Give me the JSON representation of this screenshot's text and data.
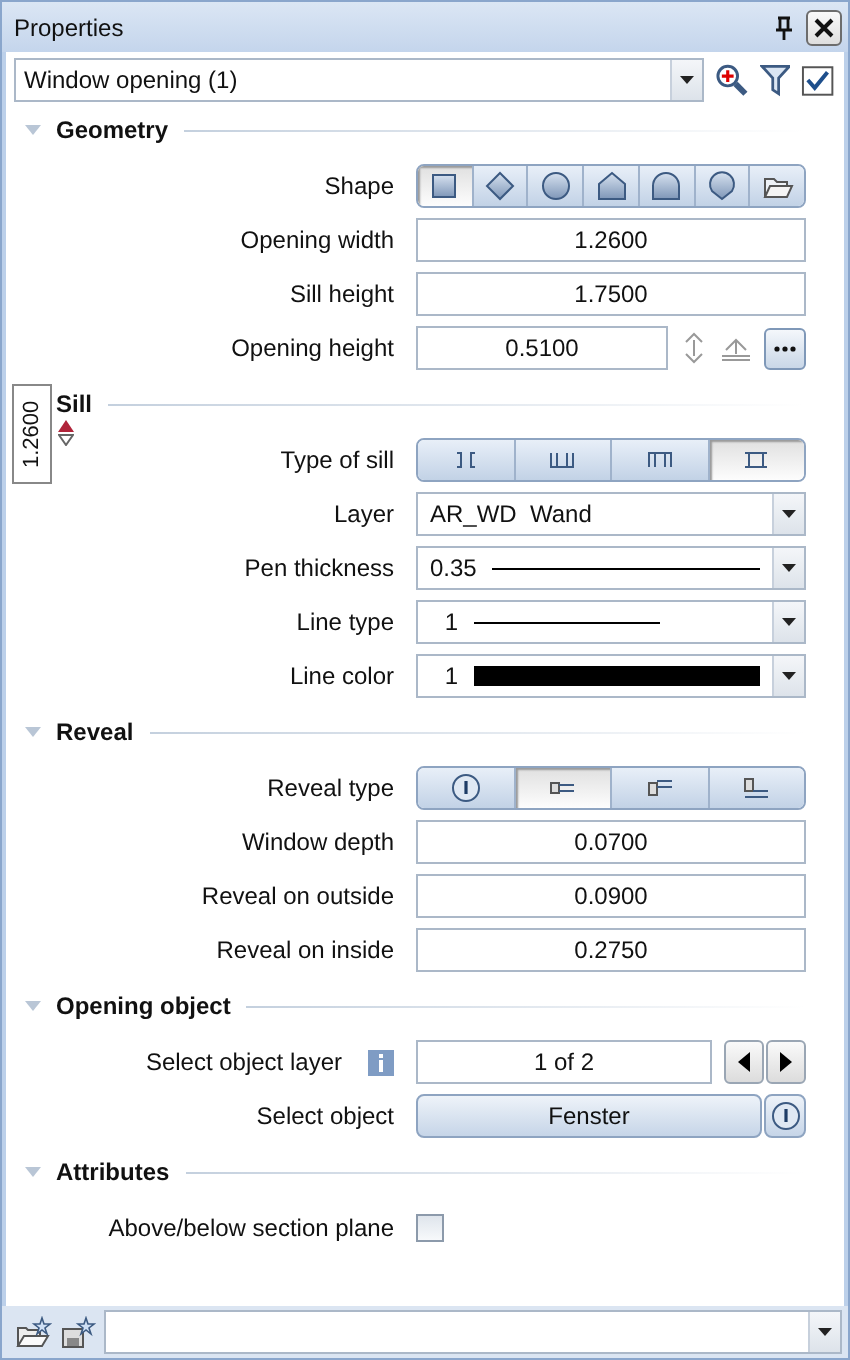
{
  "window": {
    "title": "Properties"
  },
  "selector": {
    "value": "Window opening (1)"
  },
  "sections": [
    {
      "title": "Geometry",
      "expanded": true,
      "rows": [
        {
          "kind": "shapes",
          "label": "Shape",
          "options": [
            {
              "selected": true
            },
            {
              "selected": false
            },
            {
              "selected": false
            },
            {
              "selected": false
            },
            {
              "selected": false
            },
            {
              "selected": false
            },
            {
              "selected": false
            }
          ]
        },
        {
          "kind": "number",
          "label": "Opening width",
          "value": "1.2600"
        },
        {
          "kind": "number",
          "label": "Sill height",
          "value": "1.7500"
        },
        {
          "kind": "tools",
          "label": "Opening height",
          "value": "0.5100"
        }
      ]
    },
    {
      "title": "Sill",
      "rows": [
        {
          "kind": "sills",
          "label": "Type of sill",
          "options": [
            {
              "selected": false
            },
            {
              "selected": false
            },
            {
              "selected": false
            },
            {
              "selected": true
            }
          ]
        },
        {
          "kind": "dropdown",
          "label": "Layer",
          "value": "AR_WD  Wand"
        },
        {
          "kind": "pen",
          "label": "Pen thickness",
          "value": "0.35"
        },
        {
          "kind": "linetype",
          "label": "Line type",
          "value": "1"
        },
        {
          "kind": "color",
          "label": "Line color",
          "value": "1"
        }
      ]
    },
    {
      "title": "Reveal",
      "expanded": true,
      "rows": [
        {
          "kind": "reveals",
          "label": "Reveal type",
          "options": [
            {
              "selected": false
            },
            {
              "selected": true
            },
            {
              "selected": false
            },
            {
              "selected": false
            }
          ]
        },
        {
          "kind": "number",
          "label": "Window depth",
          "value": "0.0700"
        },
        {
          "kind": "number",
          "label": "Reveal on outside",
          "value": "0.0900"
        },
        {
          "kind": "number",
          "label": "Reveal on inside",
          "value": "0.2750"
        }
      ]
    },
    {
      "title": "Opening object",
      "expanded": true,
      "rows": [
        {
          "kind": "pager",
          "label": "Select object layer",
          "value": "1 of 2"
        },
        {
          "kind": "button",
          "label": "Select object",
          "value": "Fenster"
        }
      ]
    },
    {
      "title": "Attributes",
      "expanded": true,
      "rows": [
        {
          "kind": "checkbox",
          "label": "Above/below section plane",
          "checked": false
        }
      ]
    }
  ],
  "tooltip": {
    "value": "1.2600"
  }
}
